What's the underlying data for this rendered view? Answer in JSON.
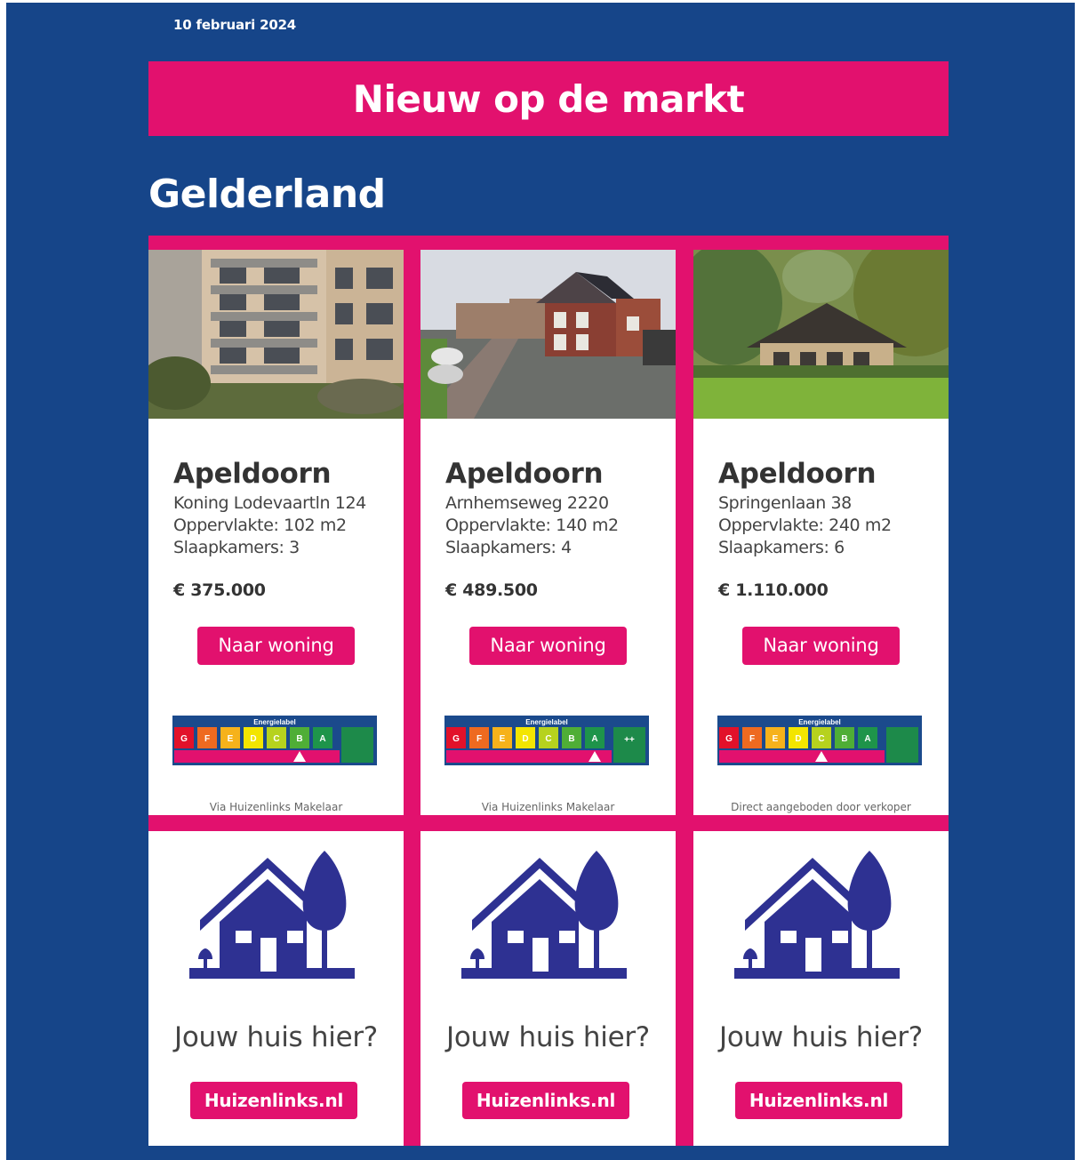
{
  "date": "10 februari 2024",
  "banner_title": "Nieuw op de markt",
  "region": "Gelderland",
  "listings": [
    {
      "city": "Apeldoorn",
      "address": "Koning Lodevaartln 124",
      "area": "Oppervlakte: 102 m2",
      "bedrooms": "Slaapkamers: 3",
      "price": "€ 375.000",
      "button": "Naar woning",
      "energy_label": "B",
      "energy_title": "Energielabel",
      "via": "Via Huizenlinks Makelaar"
    },
    {
      "city": "Apeldoorn",
      "address": "Arnhemseweg 2220",
      "area": "Oppervlakte: 140 m2",
      "bedrooms": "Slaapkamers: 4",
      "price": "€ 489.500",
      "button": "Naar woning",
      "energy_label": "A",
      "energy_title": "Energielabel",
      "via": "Via Huizenlinks Makelaar"
    },
    {
      "city": "Apeldoorn",
      "address": "Springenlaan 38",
      "area": "Oppervlakte: 240 m2",
      "bedrooms": "Slaapkamers: 6",
      "price": "€ 1.110.000",
      "button": "Naar woning",
      "energy_label": "C",
      "energy_title": "Energielabel",
      "via": "Direct aangeboden door verkoper"
    }
  ],
  "promo": {
    "text": "Jouw huis hier?",
    "button": "Huizenlinks.nl"
  },
  "energy_classes": [
    "G",
    "F",
    "E",
    "D",
    "C",
    "B",
    "A",
    "++"
  ],
  "colors": {
    "background": "#164589",
    "accent": "#e2116e",
    "icon": "#2e3192"
  }
}
